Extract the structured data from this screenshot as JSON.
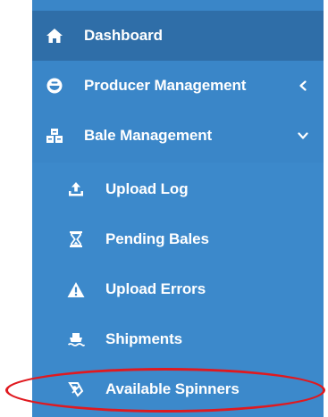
{
  "sidebar": {
    "bg_color": "#3a86c8",
    "active_color": "#2f6ea8",
    "items": [
      {
        "label": "Dashboard",
        "icon": "home-icon"
      },
      {
        "label": "Producer Management",
        "icon": "bowl-icon",
        "chevron": "chevron-left-icon"
      },
      {
        "label": "Bale Management",
        "icon": "bales-icon",
        "chevron": "chevron-down-icon"
      }
    ],
    "subitems": [
      {
        "label": "Upload Log",
        "icon": "upload-icon"
      },
      {
        "label": "Pending Bales",
        "icon": "hourglass-icon"
      },
      {
        "label": "Upload Errors",
        "icon": "warning-icon"
      },
      {
        "label": "Shipments",
        "icon": "ship-icon"
      },
      {
        "label": "Available Spinners",
        "icon": "spinner-icon"
      }
    ]
  },
  "annotation": {
    "highlight_color": "#e0191f",
    "highlighted_item": "Available Spinners"
  }
}
